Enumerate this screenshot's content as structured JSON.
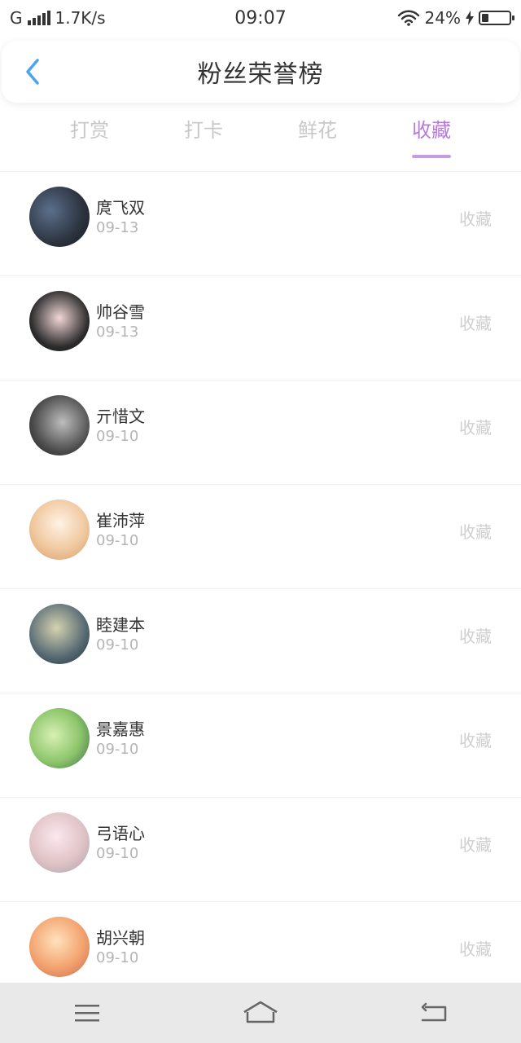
{
  "status": {
    "carrier": "G",
    "speed": "1.7K/s",
    "time": "09:07",
    "battery": "24%"
  },
  "header": {
    "title": "粉丝荣誉榜",
    "accent": "#4aa3f3"
  },
  "tabs": [
    {
      "label": "打赏"
    },
    {
      "label": "打卡"
    },
    {
      "label": "鲜花"
    },
    {
      "label": "收藏"
    }
  ],
  "list": [
    {
      "name": "庹飞双",
      "date": "09-13",
      "action": "收藏"
    },
    {
      "name": "帅谷雪",
      "date": "09-13",
      "action": "收藏"
    },
    {
      "name": "亓惜文",
      "date": "09-10",
      "action": "收藏"
    },
    {
      "name": "崔沛萍",
      "date": "09-10",
      "action": "收藏"
    },
    {
      "name": "睦建本",
      "date": "09-10",
      "action": "收藏"
    },
    {
      "name": "景嘉惠",
      "date": "09-10",
      "action": "收藏"
    },
    {
      "name": "弓语心",
      "date": "09-10",
      "action": "收藏"
    },
    {
      "name": "胡兴朝",
      "date": "09-10",
      "action": "收藏"
    }
  ],
  "colors": {
    "active_tab": "#b77ad9",
    "tab_indicator": "#c79be3",
    "nav_bg": "#e9e9e9"
  }
}
